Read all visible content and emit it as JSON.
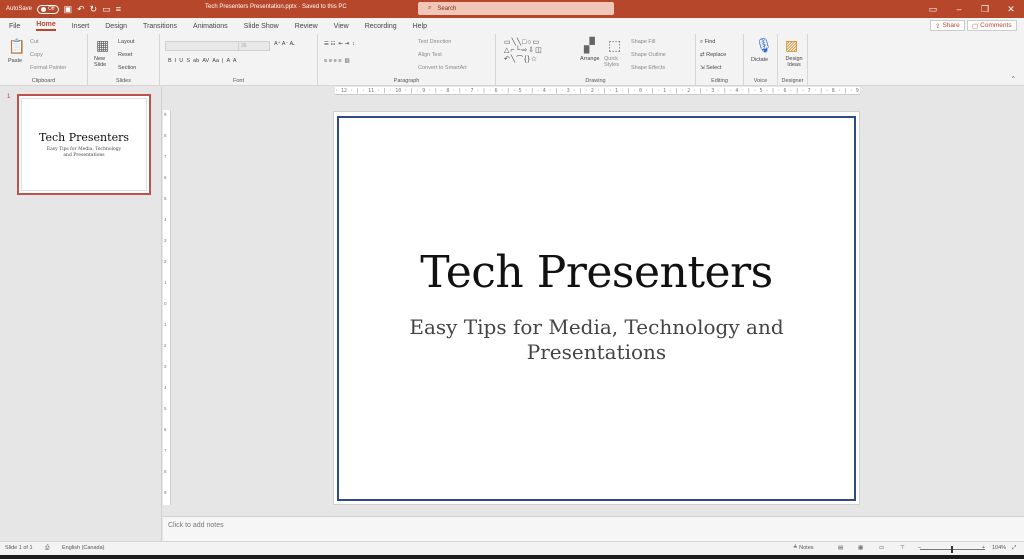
{
  "titlebar": {
    "autosave_label": "AutoSave",
    "autosave_state": "Off",
    "doc_title": "Tech Presenters Presentation.pptx · Saved to this PC",
    "search_placeholder": "Search",
    "accent": "#b7472a"
  },
  "menu": {
    "tabs": [
      "File",
      "Home",
      "Insert",
      "Design",
      "Transitions",
      "Animations",
      "Slide Show",
      "Review",
      "View",
      "Recording",
      "Help"
    ],
    "active": "Home",
    "share_label": "Share",
    "comments_label": "Comments"
  },
  "ribbon": {
    "clipboard": {
      "label": "Clipboard",
      "paste": "Paste",
      "cut": "Cut",
      "copy": "Copy",
      "format_painter": "Format Painter"
    },
    "slides": {
      "label": "Slides",
      "new_slide": "New Slide",
      "layout": "Layout",
      "reset": "Reset",
      "section": "Section"
    },
    "font": {
      "label": "Font",
      "size": "36"
    },
    "paragraph": {
      "label": "Paragraph",
      "text_direction": "Text Direction",
      "align_text": "Align Text",
      "smartart": "Convert to SmartArt"
    },
    "drawing": {
      "label": "Drawing",
      "arrange": "Arrange",
      "quick_styles": "Quick Styles",
      "shape_fill": "Shape Fill",
      "shape_outline": "Shape Outline",
      "shape_effects": "Shape Effects"
    },
    "editing": {
      "label": "Editing",
      "find": "Find",
      "replace": "Replace",
      "select": "Select"
    },
    "voice": {
      "label": "Voice",
      "dictate": "Dictate"
    },
    "designer": {
      "label": "Designer",
      "design_ideas": "Design Ideas"
    }
  },
  "thumbnails": [
    {
      "number": "1",
      "title": "Tech Presenters",
      "subtitle": "Easy Tips for Media, Technology and Presentations"
    }
  ],
  "ruler": {
    "h_labels": "· 12 · | · 11 · | · 10 · | · 9 · | · 8 · | · 7 · | · 6 · | · 5 · | · 4 · | · 3 · | · 2 · | · 1 · | · 0 · | · 1 · | · 2 · | · 3 · | · 4 · | · 5 · | · 6 · | · 7 · | · 8 · | · 9 · | · 10 · | · 11 · | · 12 ·",
    "v_labels": [
      "9",
      "8",
      "7",
      "6",
      "5",
      "4",
      "3",
      "2",
      "1",
      "0",
      "1",
      "2",
      "3",
      "4",
      "5",
      "6",
      "7",
      "8",
      "9"
    ]
  },
  "slide": {
    "title": "Tech Presenters",
    "subtitle": "Easy Tips for Media, Technology and Presentations",
    "border_color": "#2e4a8a"
  },
  "notes": {
    "placeholder": "Click to add notes"
  },
  "status": {
    "slide_of": "Slide 1 of 1",
    "language": "English (Canada)",
    "notes_label": "Notes",
    "zoom": "104%"
  }
}
